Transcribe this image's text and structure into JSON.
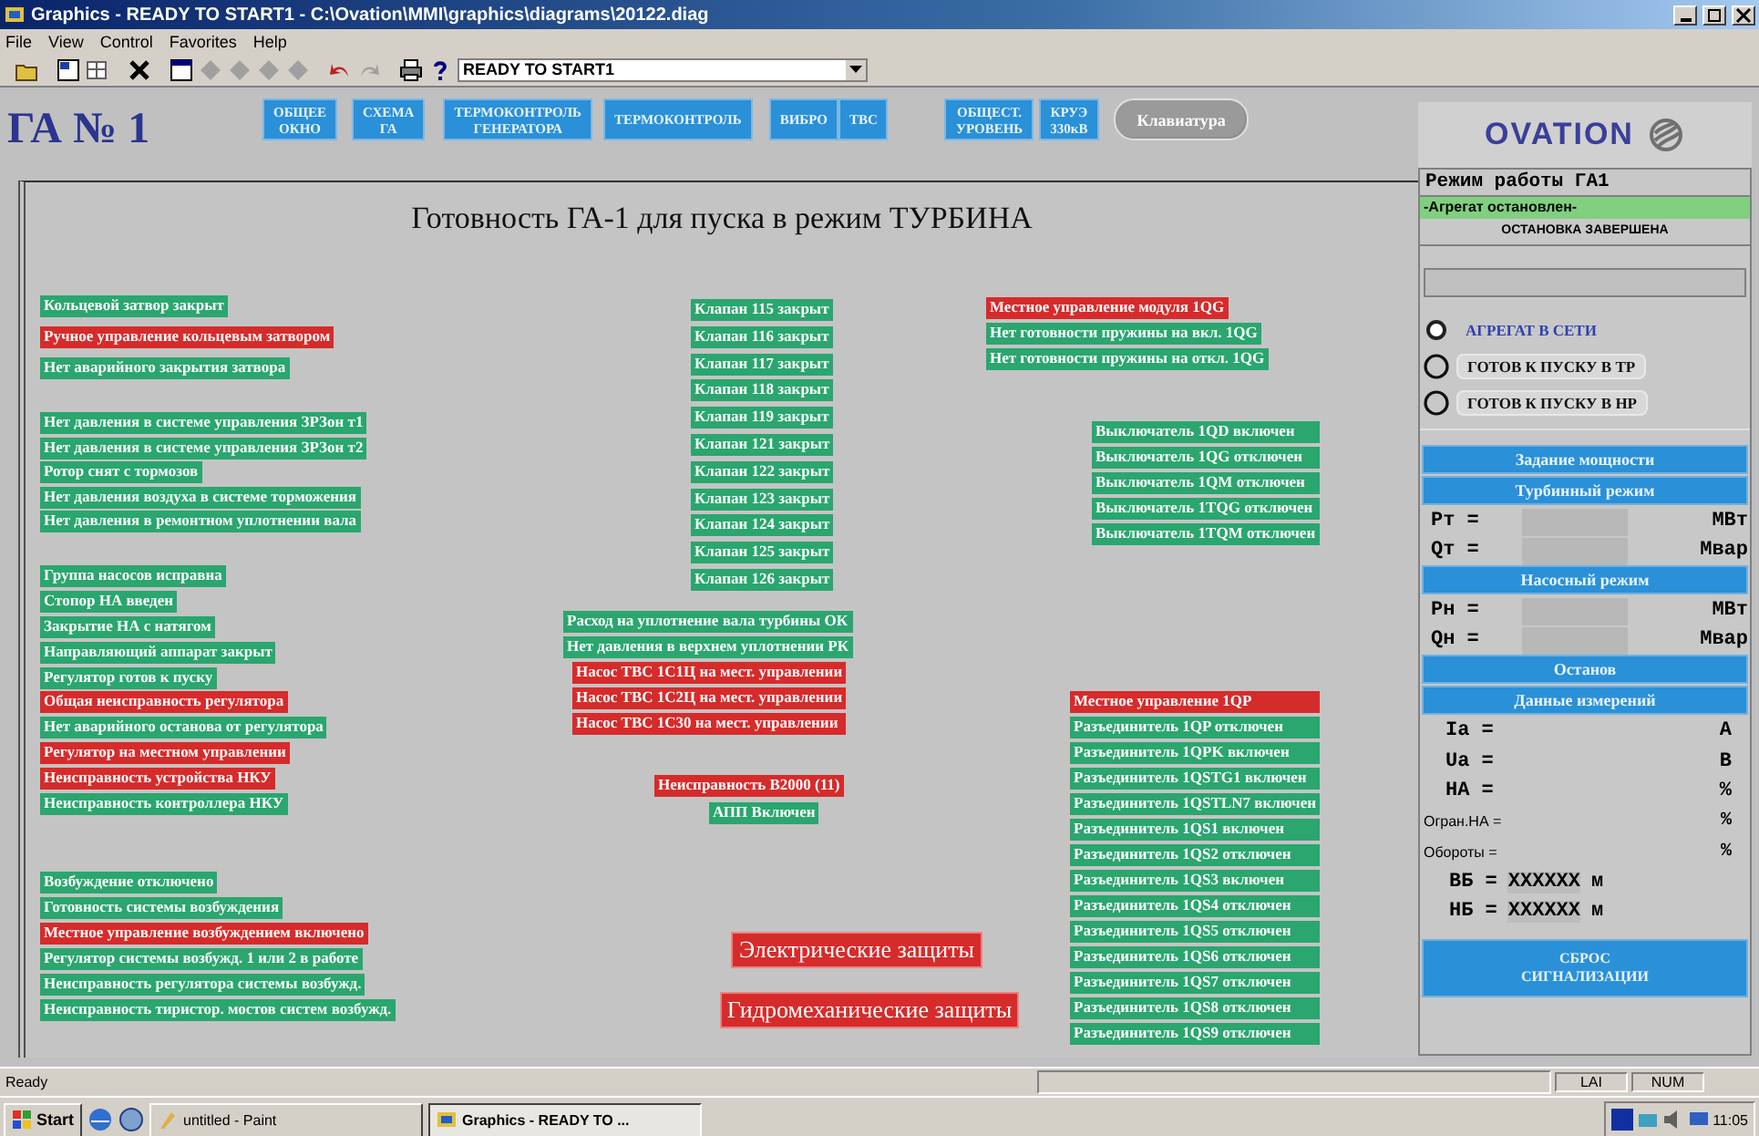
{
  "window": {
    "title": "Graphics - READY TO START1 - C:\\Ovation\\MMI\\graphics\\diagrams\\20122.diag"
  },
  "menu": [
    "File",
    "View",
    "Control",
    "Favorites",
    "Help"
  ],
  "toolbar": {
    "combo_value": "READY TO START1"
  },
  "header": {
    "unit": "ГА № 1",
    "nav_buttons": [
      {
        "label": "ОБЩЕЕ\nОКНО"
      },
      {
        "label": "СХЕМА\nГА"
      },
      {
        "label": "ТЕРМОКОНТРОЛЬ\nГЕНЕРАТОРА"
      },
      {
        "label": "ТЕРМОКОНТРОЛЬ"
      },
      {
        "label": "ВИБРО"
      },
      {
        "label": "ТВС"
      },
      {
        "label": "ОБЩЕСТ.\nУРОВЕНЬ"
      },
      {
        "label": "КРУЭ\n330кВ"
      }
    ],
    "keyboard_button": "Клавиатура",
    "logo": "OVATION"
  },
  "diagram": {
    "title": "Готовность ГА-1 для пуска в режим ТУРБИНА",
    "groups": [
      {
        "items": [
          {
            "text": "Кольцевой затвор закрыт",
            "color": "#2aa66e"
          },
          {
            "text": "Ручное управление кольцевым затвором",
            "color": "#d62b2b"
          },
          {
            "text": "Нет аварийного закрытия затвора",
            "color": "#2aa66e"
          }
        ]
      },
      {
        "items": [
          {
            "text": "Нет давления в системе управления ЗРЗон т1",
            "color": "#2aa66e"
          },
          {
            "text": "Нет давления в системе управления ЗРЗон т2",
            "color": "#2aa66e"
          },
          {
            "text": "Ротор снят с тормозов",
            "color": "#2aa66e"
          },
          {
            "text": "Нет давления воздуха в системе торможения",
            "color": "#2aa66e"
          },
          {
            "text": "Нет давления в ремонтном уплотнении вала",
            "color": "#2aa66e"
          }
        ]
      },
      {
        "items": [
          {
            "text": "Группа насосов исправна",
            "color": "#2aa66e"
          },
          {
            "text": "Стопор НА введен",
            "color": "#2aa66e"
          },
          {
            "text": "Закрытие НА с натягом",
            "color": "#2aa66e"
          },
          {
            "text": "Направляющий аппарат закрыт",
            "color": "#2aa66e"
          },
          {
            "text": "Регулятор готов к пуску",
            "color": "#2aa66e"
          },
          {
            "text": "Общая неисправность регулятора",
            "color": "#d62b2b"
          },
          {
            "text": "Нет аварийного останова от регулятора",
            "color": "#2aa66e"
          },
          {
            "text": "Регулятор на местном управлении",
            "color": "#d62b2b"
          },
          {
            "text": "Неисправность устройства НКУ",
            "color": "#d62b2b"
          },
          {
            "text": "Неисправность контроллера НКУ",
            "color": "#2aa66e"
          }
        ]
      },
      {
        "items": [
          {
            "text": "Возбуждение отключено",
            "color": "#2aa66e"
          },
          {
            "text": "Готовность системы возбуждения",
            "color": "#2aa66e"
          },
          {
            "text": "Местное управление возбуждением включено",
            "color": "#d62b2b"
          },
          {
            "text": "Регулятор системы возбужд. 1 или 2 в работе",
            "color": "#2aa66e"
          },
          {
            "text": "Неисправность регулятора системы возбужд.",
            "color": "#2aa66e"
          },
          {
            "text": "Неисправность тиристор. мостов систем возбужд.",
            "color": "#2aa66e"
          }
        ]
      },
      {
        "items": [
          {
            "text": "Клапан 115 закрыт",
            "color": "#2aa66e"
          },
          {
            "text": "Клапан 116 закрыт",
            "color": "#2aa66e"
          },
          {
            "text": "Клапан 117 закрыт",
            "color": "#2aa66e"
          },
          {
            "text": "Клапан 118 закрыт",
            "color": "#2aa66e"
          },
          {
            "text": "Клапан 119 закрыт",
            "color": "#2aa66e"
          },
          {
            "text": "Клапан 121 закрыт",
            "color": "#2aa66e"
          },
          {
            "text": "Клапан 122 закрыт",
            "color": "#2aa66e"
          },
          {
            "text": "Клапан 123 закрыт",
            "color": "#2aa66e"
          },
          {
            "text": "Клапан 124 закрыт",
            "color": "#2aa66e"
          },
          {
            "text": "Клапан 125 закрыт",
            "color": "#2aa66e"
          },
          {
            "text": "Клапан 126 закрыт",
            "color": "#2aa66e"
          }
        ]
      },
      {
        "items": [
          {
            "text": "Расход на уплотнение вала турбины ОК",
            "color": "#2aa66e"
          },
          {
            "text": "Нет давления в верхнем уплотнении РК",
            "color": "#2aa66e"
          }
        ]
      },
      {
        "items": [
          {
            "text": "Насос ТВС 1С1Ц на мест. управлении",
            "color": "#d62b2b"
          },
          {
            "text": "Насос ТВС 1С2Ц на мест. управлении",
            "color": "#d62b2b"
          },
          {
            "text": "Насос ТВС 1С30 на мест. управлении",
            "color": "#d62b2b"
          }
        ]
      },
      {
        "items": [
          {
            "text": "Неисправность В2000 (11)",
            "color": "#d62b2b"
          }
        ]
      },
      {
        "items": [
          {
            "text": "АПП Включен",
            "color": "#2aa66e"
          }
        ]
      },
      {
        "items": [
          {
            "text": "Местное управление модуля 1QG",
            "color": "#d62b2b"
          },
          {
            "text": "Нет готовности пружины на вкл. 1QG",
            "color": "#2aa66e"
          },
          {
            "text": "Нет готовности пружины на откл. 1QG",
            "color": "#2aa66e"
          }
        ]
      },
      {
        "items": [
          {
            "text": "Выключатель 1QD включен",
            "color": "#2aa66e"
          },
          {
            "text": "Выключатель 1QG отключен",
            "color": "#2aa66e"
          },
          {
            "text": "Выключатель 1QM отключен",
            "color": "#2aa66e"
          },
          {
            "text": "Выключатель 1TQG отключен",
            "color": "#2aa66e"
          },
          {
            "text": "Выключатель 1TQM отключен",
            "color": "#2aa66e"
          }
        ]
      },
      {
        "items": [
          {
            "text": "Местное управление 1QP",
            "color": "#d62b2b"
          },
          {
            "text": "Разъединитель 1QP отключен",
            "color": "#2aa66e"
          },
          {
            "text": "Разъединитель 1QPK включен",
            "color": "#2aa66e"
          },
          {
            "text": "Разъединитель 1QSTG1 включен",
            "color": "#2aa66e"
          },
          {
            "text": "Разъединитель 1QSTLN7 включен",
            "color": "#2aa66e"
          },
          {
            "text": "Разъединитель 1QS1 включен",
            "color": "#2aa66e"
          },
          {
            "text": "Разъединитель 1QS2 отключен",
            "color": "#2aa66e"
          },
          {
            "text": "Разъединитель 1QS3 включен",
            "color": "#2aa66e"
          },
          {
            "text": "Разъединитель 1QS4 отключен",
            "color": "#2aa66e"
          },
          {
            "text": "Разъединитель 1QS5 отключен",
            "color": "#2aa66e"
          },
          {
            "text": "Разъединитель 1QS6 отключен",
            "color": "#2aa66e"
          },
          {
            "text": "Разъединитель 1QS7 отключен",
            "color": "#2aa66e"
          },
          {
            "text": "Разъединитель 1QS8 отключен",
            "color": "#2aa66e"
          },
          {
            "text": "Разъединитель 1QS9 отключен",
            "color": "#2aa66e"
          }
        ]
      }
    ],
    "protection_buttons": [
      {
        "label": "Электрические защиты"
      },
      {
        "label": "Гидромеханические защиты"
      }
    ]
  },
  "mode_panel": {
    "title": "Режим работы ГА1",
    "status": "-Агрегат остановлен-",
    "substatus": "ОСТАНОВКА ЗАВЕРШЕНА",
    "states": [
      {
        "label": "АГРЕГАТ В СЕТИ",
        "selected": true
      },
      {
        "label": "ГОТОВ К ПУСКУ В ТР",
        "selected": false
      },
      {
        "label": "ГОТОВ К ПУСКУ В НР",
        "selected": false
      }
    ],
    "controls": [
      {
        "kind": "button",
        "label": "Задание мощности"
      },
      {
        "kind": "button",
        "label": "Турбинный режим"
      },
      {
        "kind": "setpoint",
        "name": "Pт =",
        "unit": "МВт"
      },
      {
        "kind": "setpoint",
        "name": "Qт =",
        "unit": "Мвар"
      },
      {
        "kind": "button",
        "label": "Насосный режим"
      },
      {
        "kind": "setpoint",
        "name": "Pн =",
        "unit": "МВт"
      },
      {
        "kind": "setpoint",
        "name": "Qн =",
        "unit": "Мвар"
      },
      {
        "kind": "button",
        "label": "Останов"
      },
      {
        "kind": "button",
        "label": "Данные измерений"
      },
      {
        "kind": "reading",
        "name": "Ia =",
        "unit": "А"
      },
      {
        "kind": "reading",
        "name": "Ua =",
        "unit": "В"
      },
      {
        "kind": "reading",
        "name": "НА =",
        "unit": "%"
      },
      {
        "kind": "minor_reading",
        "name": "Огран.НА =",
        "unit": "%"
      },
      {
        "kind": "minor_reading",
        "name": "Обороты =",
        "unit": "%"
      },
      {
        "kind": "level",
        "name": "ВБ =",
        "value": "ХХХХХХ",
        "unit": "м"
      },
      {
        "kind": "level",
        "name": "НБ =",
        "value": "ХХХХХХ",
        "unit": "м"
      },
      {
        "kind": "big_button",
        "label": "СБРОС\nСИГНАЛИЗАЦИИ"
      }
    ]
  },
  "status_bar": {
    "text": "Ready",
    "indicators": [
      "LAI",
      "NUM"
    ]
  },
  "taskbar": {
    "start": "Start",
    "tasks": [
      {
        "label": "untitled - Paint",
        "selected": false
      },
      {
        "label": "Graphics - READY TO ...",
        "selected": true
      }
    ],
    "clock": "11:05"
  }
}
